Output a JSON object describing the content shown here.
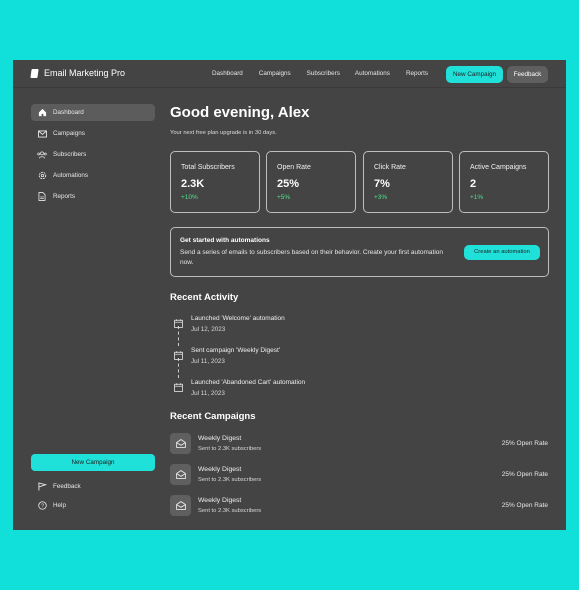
{
  "app": {
    "name": "Email Marketing Pro"
  },
  "topnav": {
    "items": [
      "Dashboard",
      "Campaigns",
      "Subscribers",
      "Automations",
      "Reports"
    ],
    "new_campaign": "New Campaign",
    "feedback": "Feedback"
  },
  "sidebar": {
    "items": [
      {
        "label": "Dashboard",
        "icon": "home-icon",
        "active": true
      },
      {
        "label": "Campaigns",
        "icon": "mail-icon",
        "active": false
      },
      {
        "label": "Subscribers",
        "icon": "users-icon",
        "active": false
      },
      {
        "label": "Automations",
        "icon": "gear-icon",
        "active": false
      },
      {
        "label": "Reports",
        "icon": "document-icon",
        "active": false
      }
    ],
    "new_campaign": "New Campaign",
    "feedback": "Feedback",
    "help": "Help"
  },
  "main": {
    "greeting": "Good evening, Alex",
    "subtitle": "Your next free plan upgrade is in 30 days.",
    "stats": [
      {
        "label": "Total Subscribers",
        "value": "2.3K",
        "change": "+10%"
      },
      {
        "label": "Open Rate",
        "value": "25%",
        "change": "+5%"
      },
      {
        "label": "Click Rate",
        "value": "7%",
        "change": "+3%"
      },
      {
        "label": "Active Campaigns",
        "value": "2",
        "change": "+1%"
      }
    ],
    "promo": {
      "title": "Get started with automations",
      "description": "Send a series of emails to subscribers based on their behavior. Create your first automation now.",
      "button": "Create an automation"
    },
    "recent_activity": {
      "title": "Recent Activity",
      "items": [
        {
          "title": "Launched 'Welcome' automation",
          "date": "Jul 12, 2023"
        },
        {
          "title": "Sent campaign 'Weekly Digest'",
          "date": "Jul 11, 2023"
        },
        {
          "title": "Launched 'Abandoned Cart' automation",
          "date": "Jul 11, 2023"
        }
      ]
    },
    "recent_campaigns": {
      "title": "Recent Campaigns",
      "items": [
        {
          "name": "Weekly Digest",
          "meta": "Sent to 2.3K subscribers",
          "rate": "25% Open Rate"
        },
        {
          "name": "Weekly Digest",
          "meta": "Sent to 2.3K subscribers",
          "rate": "25% Open Rate"
        },
        {
          "name": "Weekly Digest",
          "meta": "Sent to 2.3K subscribers",
          "rate": "25% Open Rate"
        }
      ]
    }
  },
  "colors": {
    "accent": "#1fe1d9",
    "page_background": "#10e0d9",
    "app_background": "#444444",
    "positive": "#4fe08a"
  }
}
